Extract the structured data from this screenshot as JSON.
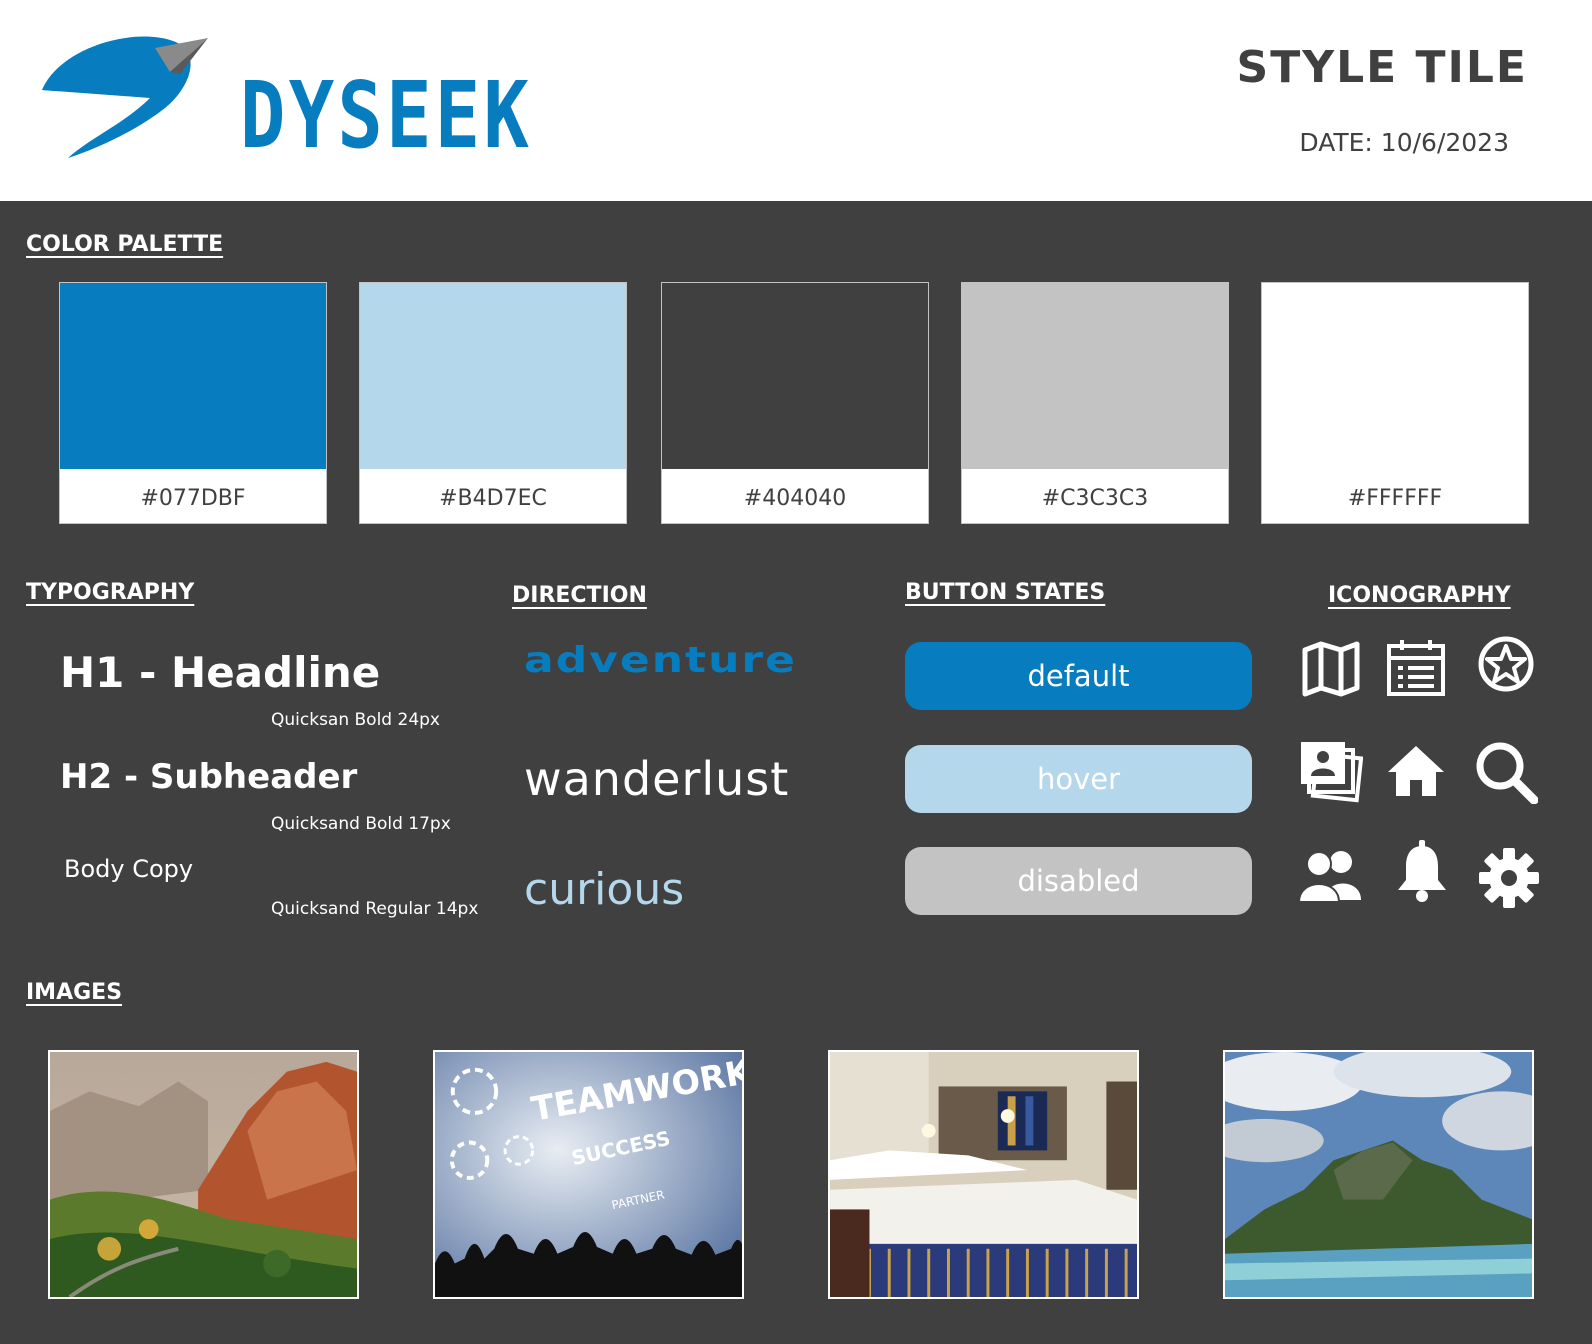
{
  "header": {
    "brand": "DYSEEK",
    "title": "STYLE TILE",
    "date": "DATE: 10/6/2023"
  },
  "sections": {
    "color_palette": "COLOR PALETTE",
    "typography": "TYPOGRAPHY",
    "direction": "DIRECTION",
    "button_states": "BUTTON STATES",
    "iconography": "ICONOGRAPHY",
    "images": "IMAGES"
  },
  "palette": [
    {
      "hex": "#077DBF",
      "color": "#077DBF"
    },
    {
      "hex": "#B4D7EC",
      "color": "#B4D7EC"
    },
    {
      "hex": "#404040",
      "color": "#404040"
    },
    {
      "hex": "#C3C3C3",
      "color": "#C3C3C3"
    },
    {
      "hex": "#FFFFFF",
      "color": "#FFFFFF"
    }
  ],
  "typography": {
    "h1": "H1 - Headline",
    "h1_note": "Quicksan Bold 24px",
    "h2": "H2 - Subheader",
    "h2_note": "Quicksand Bold 17px",
    "body": "Body Copy",
    "body_note": "Quicksand Regular 14px"
  },
  "direction": {
    "word1": "adventure",
    "word2": "wanderlust",
    "word3": "curious",
    "word1_color": "#077DBF",
    "word2_color": "#FFFFFF",
    "word3_color": "#B4D7EC"
  },
  "buttons": {
    "default": "default",
    "hover": "hover",
    "disabled": "disabled",
    "default_color": "#077DBF",
    "hover_color": "#B4D7EC",
    "disabled_color": "#C3C3C3"
  },
  "icons": [
    "map-icon",
    "calendar-list-icon",
    "star-circle-icon",
    "photo-gallery-icon",
    "home-icon",
    "search-icon",
    "users-icon",
    "bell-icon",
    "gear-icon"
  ],
  "images": [
    "canyon-mountain-photo",
    "teamwork-success-photo",
    "hotel-room-photo",
    "tropical-island-photo"
  ]
}
